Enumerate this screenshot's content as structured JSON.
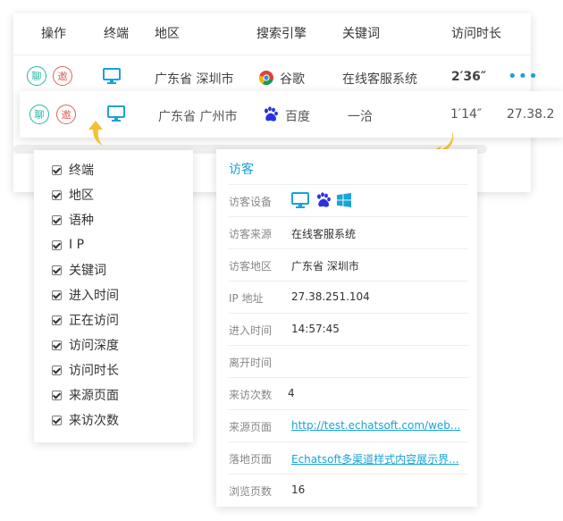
{
  "table": {
    "headers": [
      "操作",
      "终端",
      "地区",
      "搜索引擎",
      "关键词",
      "访问时长"
    ],
    "row": {
      "chat": "聊",
      "invite": "邀",
      "region": "广东省 深圳市",
      "engine": "谷歌",
      "keyword": "在线客服系统",
      "duration": "2′36″",
      "more": "•••"
    }
  },
  "highlight_row": {
    "chat": "聊",
    "invite": "邀",
    "region": "广东省 广州市",
    "engine": "百度",
    "keyword": "一洽",
    "duration": "1′14″",
    "ip": "27.38.2"
  },
  "columns": [
    "终端",
    "地区",
    "语种",
    "I P",
    "关键词",
    "进入时间",
    "正在访问",
    "访问深度",
    "访问时长",
    "来源页面",
    "来访次数"
  ],
  "detail": {
    "title": "访客",
    "rows": [
      {
        "label": "访客设备",
        "value": ""
      },
      {
        "label": "访客来源",
        "value": "在线客服系统"
      },
      {
        "label": "访客地区",
        "value": "广东省 深圳市"
      },
      {
        "label": "IP 地址",
        "value": "27.38.251.104"
      },
      {
        "label": "进入时间",
        "value": "14:57:45"
      },
      {
        "label": "离开时间",
        "value": ""
      },
      {
        "label": "来访次数",
        "value": "4"
      },
      {
        "label": "来源页面",
        "value": "http://test.echatsoft.com/web..."
      },
      {
        "label": "落地页面",
        "value": "Echatsoft多渠道样式内容展示界..."
      },
      {
        "label": "浏览页数",
        "value": "16"
      }
    ]
  },
  "colors": {
    "accent": "#1aa3d6",
    "chat": "#27b5a3",
    "invite": "#e4605b",
    "arrow": "#f5c031"
  }
}
